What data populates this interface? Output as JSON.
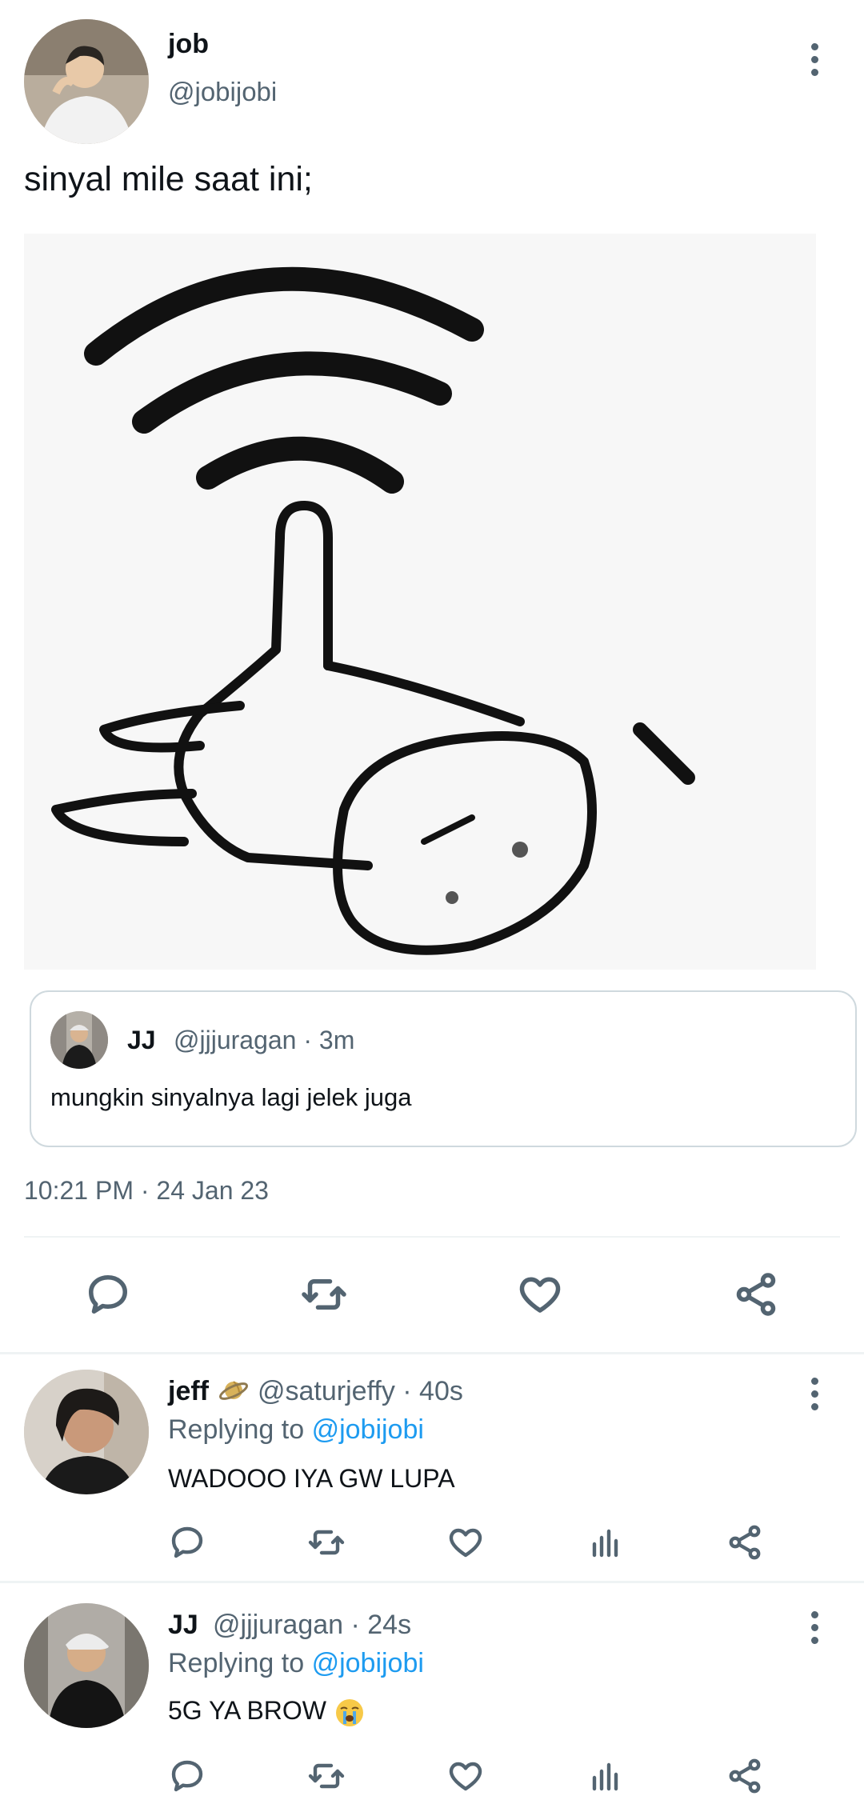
{
  "tweet": {
    "author_name": "job",
    "author_handle": "@jobijobi",
    "text": "sinyal mile saat ini;",
    "timestamp": "10:21 PM · 24 Jan 23",
    "media_icon": "wifi-signal-thumbs-up-phone-meme"
  },
  "quoted_tweet": {
    "author_name": "JJ",
    "meta": "@jjjuragan · 3m",
    "text": "mungkin sinyalnya lagi jelek juga"
  },
  "action_bar": {
    "icons": [
      "reply-icon",
      "retweet-icon",
      "like-icon",
      "share-icon"
    ]
  },
  "replies": [
    {
      "author_name": "jeff",
      "badge_icon": "saturn-emoji",
      "meta": "@saturjeffy · 40s",
      "replying_prefix": "Replying to",
      "replying_to": "@jobijobi",
      "text": "WADOOO IYA GW LUPA",
      "icons": [
        "reply-icon",
        "retweet-icon",
        "like-icon",
        "analytics-icon",
        "share-icon"
      ]
    },
    {
      "author_name": "JJ",
      "meta": "@jjjuragan · 24s",
      "replying_prefix": "Replying to",
      "replying_to": "@jobijobi",
      "text": "5G YA BROW",
      "emoji_icon": "loudly-crying-face-emoji",
      "icons": [
        "reply-icon",
        "retweet-icon",
        "like-icon",
        "analytics-icon",
        "share-icon"
      ]
    }
  ],
  "colors": {
    "primary_text": "#0f1419",
    "secondary_text": "#536471",
    "link": "#1d9bf0",
    "divider": "#eff3f4",
    "card_border": "#cfd9de"
  }
}
